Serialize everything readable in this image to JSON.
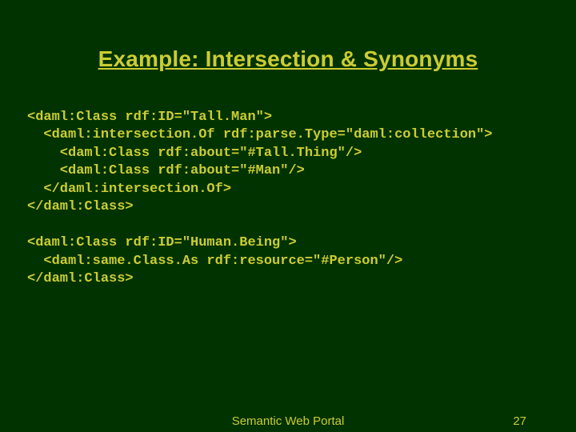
{
  "title": "Example: Intersection & Synonyms",
  "code": "<daml:Class rdf:ID=\"Tall.Man\">\n  <daml:intersection.Of rdf:parse.Type=\"daml:collection\">\n    <daml:Class rdf:about=\"#Tall.Thing\"/>\n    <daml:Class rdf:about=\"#Man\"/>\n  </daml:intersection.Of>\n</daml:Class>\n\n<daml:Class rdf:ID=\"Human.Being\">\n  <daml:same.Class.As rdf:resource=\"#Person\"/>\n</daml:Class>",
  "footer": {
    "center": "Semantic Web Portal",
    "page": "27"
  }
}
